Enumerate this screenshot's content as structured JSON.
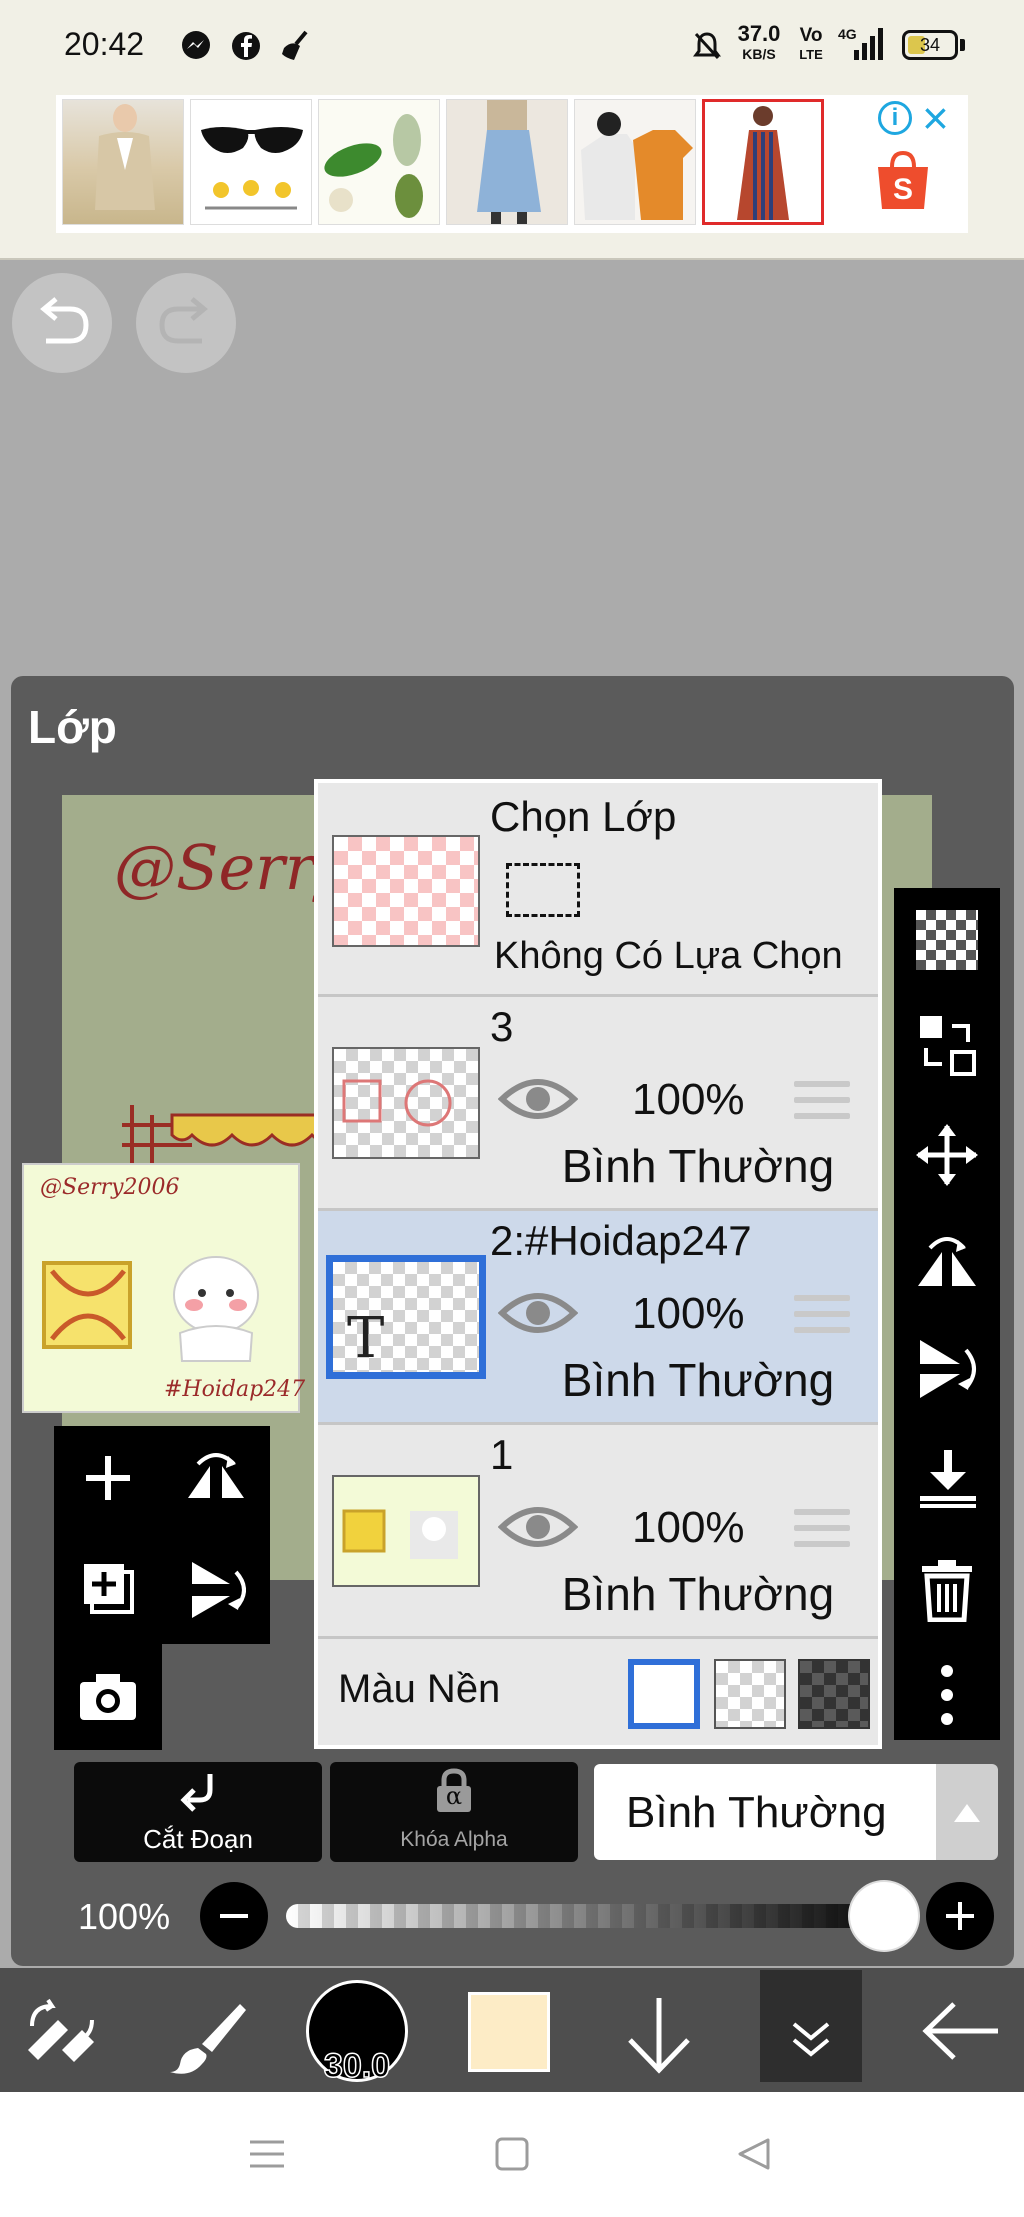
{
  "status": {
    "time": "20:42",
    "net_speed_value": "37.0",
    "net_speed_unit": "KB/S",
    "volte_top": "Vo",
    "volte_bottom": "LTE",
    "signal_label": "4G",
    "battery": "34"
  },
  "ad": {
    "info_icon": "i",
    "close_icon": "×"
  },
  "panel": {
    "title": "Lớp",
    "canvas_watermark": "@Serry",
    "preview_watermark_top": "@Serry2006",
    "preview_watermark_bottom": "#Hoidap247"
  },
  "layers": {
    "selection_row": {
      "title": "Chọn Lớp",
      "subtitle": "Không Có Lựa Chọn"
    },
    "items": [
      {
        "name": "3",
        "opacity": "100%",
        "blend": "Bình Thường",
        "selected": false
      },
      {
        "name": "2:#Hoidap247",
        "opacity": "100%",
        "blend": "Bình Thường",
        "selected": true,
        "thumb_letter": "T"
      },
      {
        "name": "1",
        "opacity": "100%",
        "blend": "Bình Thường",
        "selected": false
      }
    ],
    "background_label": "Màu Nền"
  },
  "bottom_controls": {
    "clip_label": "Cắt Đoạn",
    "alpha_lock_label": "Khóa Alpha",
    "alpha_symbol": "α",
    "blend_mode_value": "Bình Thường",
    "opacity_label": "100%",
    "opacity_value": 1.0
  },
  "toolbar": {
    "brush_size": "30.0",
    "current_color": "#fdecc6"
  },
  "colors": {
    "selected_layer": "#cdd9ea",
    "selection_border": "#2f6fd8",
    "panel": "#5b5b5b"
  }
}
